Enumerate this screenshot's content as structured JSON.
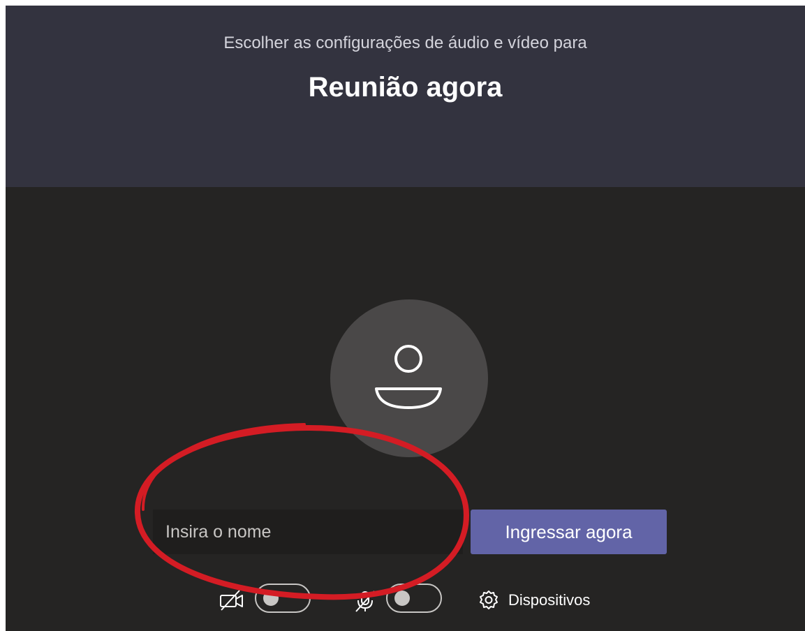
{
  "header": {
    "subtitle": "Escolher as configurações de áudio e vídeo para",
    "title": "Reunião agora"
  },
  "prejoin": {
    "avatar_icon": "person-icon",
    "name_placeholder": "Insira o nome",
    "name_value": "",
    "join_label": "Ingressar agora",
    "camera": {
      "icon": "camera-off-icon",
      "enabled": false
    },
    "microphone": {
      "icon": "mic-off-icon",
      "enabled": false
    },
    "devices_icon": "gear-icon",
    "devices_label": "Dispositivos"
  },
  "colors": {
    "header_bg": "#33333f",
    "stage_bg": "#252423",
    "avatar_bg": "#4a4848",
    "accent": "#6264a7",
    "annotation": "#d41c24"
  }
}
